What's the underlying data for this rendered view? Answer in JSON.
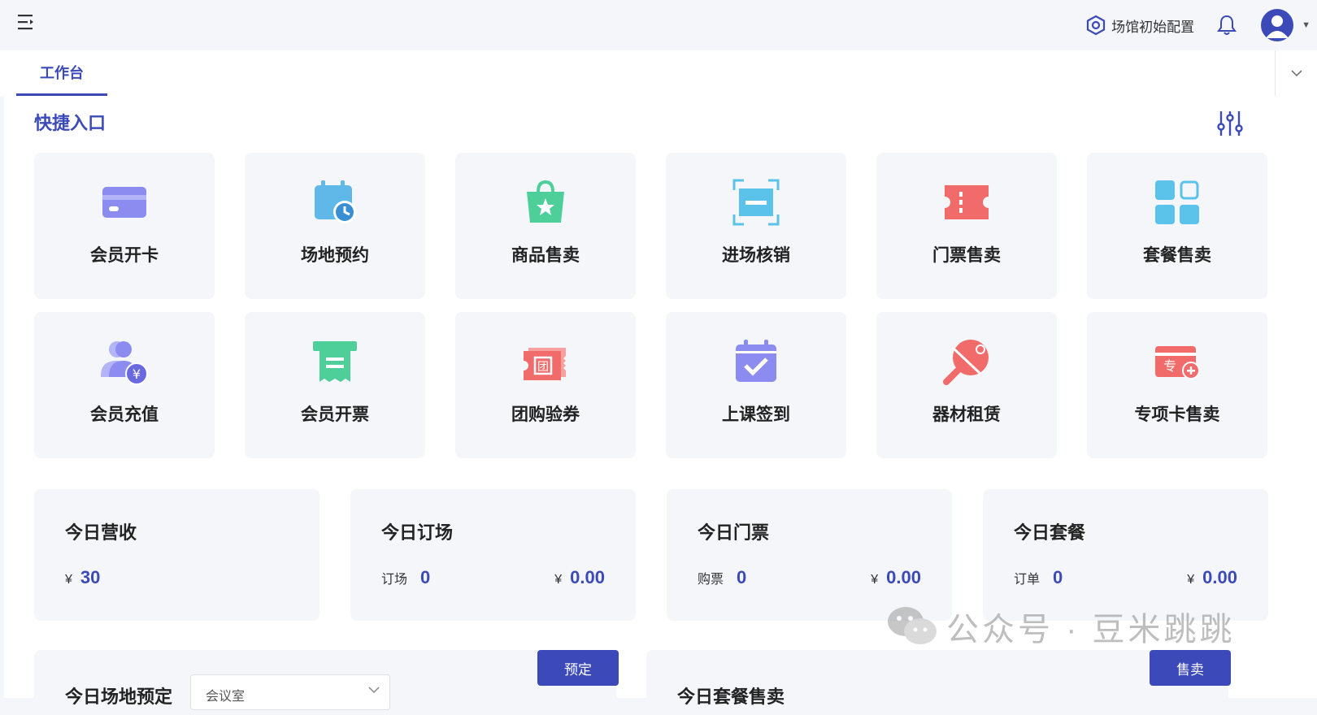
{
  "header": {
    "config_label": "场馆初始配置"
  },
  "tabs": [
    {
      "label": "工作台"
    }
  ],
  "quick": {
    "title": "快捷入口",
    "items": [
      {
        "label": "会员开卡",
        "icon": "member-card-icon",
        "color": "#8c8cf0"
      },
      {
        "label": "场地预约",
        "icon": "calendar-clock-icon",
        "color": "#5fb8e8"
      },
      {
        "label": "商品售卖",
        "icon": "shopping-bag-icon",
        "color": "#4ecf9a"
      },
      {
        "label": "进场核销",
        "icon": "scan-icon",
        "color": "#5bc2ea"
      },
      {
        "label": "门票售卖",
        "icon": "ticket-icon",
        "color": "#f26b6b"
      },
      {
        "label": "套餐售卖",
        "icon": "grid-icon",
        "color": "#5bc2ea"
      },
      {
        "label": "会员充值",
        "icon": "member-recharge-icon",
        "color": "#8c8cf0"
      },
      {
        "label": "会员开票",
        "icon": "invoice-icon",
        "color": "#4ecf9a"
      },
      {
        "label": "团购验券",
        "icon": "coupon-icon",
        "color": "#f26b6b"
      },
      {
        "label": "上课签到",
        "icon": "calendar-check-icon",
        "color": "#8c8cf0"
      },
      {
        "label": "器材租赁",
        "icon": "ping-pong-icon",
        "color": "#f26b6b"
      },
      {
        "label": "专项卡售卖",
        "icon": "special-card-icon",
        "color": "#f26b6b"
      }
    ]
  },
  "stats": [
    {
      "title": "今日营收",
      "currency": "¥",
      "value": "30"
    },
    {
      "title": "今日订场",
      "key": "订场",
      "count": "0",
      "currency": "¥",
      "amount": "0.00"
    },
    {
      "title": "今日门票",
      "key": "购票",
      "count": "0",
      "currency": "¥",
      "amount": "0.00"
    },
    {
      "title": "今日套餐",
      "key": "订单",
      "count": "0",
      "currency": "¥",
      "amount": "0.00"
    }
  ],
  "panels": {
    "left": {
      "title": "今日场地预定",
      "button": "预定",
      "select_value": "会议室"
    },
    "right": {
      "title": "今日套餐售卖",
      "button": "售卖"
    }
  },
  "watermark": "公众号 · 豆米跳跳",
  "colors": {
    "accent": "#3b4ab8",
    "card_bg": "#f4f6fa"
  }
}
